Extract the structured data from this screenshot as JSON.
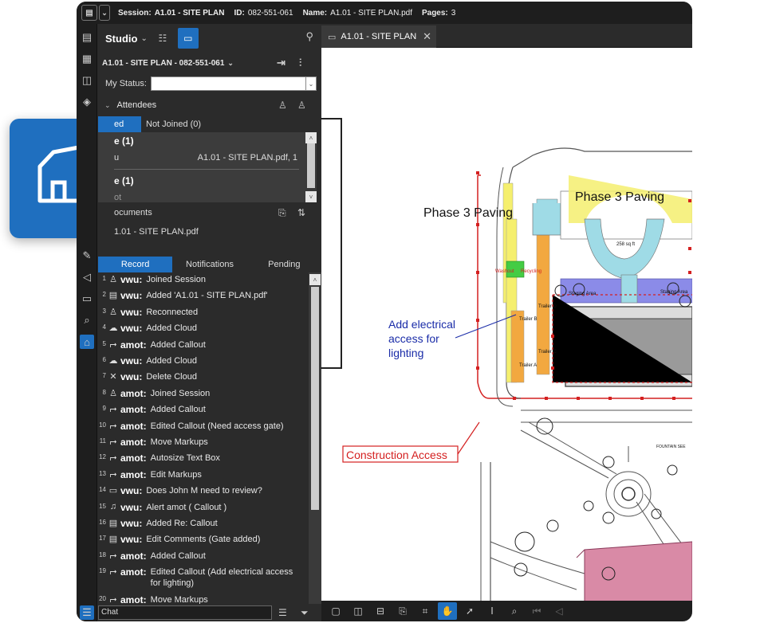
{
  "titlebar": {
    "session_label": "Session:",
    "session_value": "A1.01 - SITE PLAN",
    "id_label": "ID:",
    "id_value": "082-551-061",
    "name_label": "Name:",
    "name_value": "A1.01 - SITE PLAN.pdf",
    "pages_label": "Pages:",
    "pages_value": "3"
  },
  "panel": {
    "title": "Studio",
    "session_name": "A1.01 - SITE PLAN - 082-551-061",
    "status_label": "My Status:",
    "status_value": "",
    "attendees_label": "Attendees",
    "tabs": [
      {
        "label": "Joined"
      },
      {
        "label": "Not Joined (0)"
      }
    ],
    "visible_tab_text": "ed",
    "attendees": {
      "group1": "e (1)",
      "person1": "u",
      "person1_doc": "A1.01 - SITE PLAN.pdf, 1",
      "group2": "e (1)",
      "person2": "ot"
    },
    "documents_label": "ocuments",
    "document_item": "1.01 - SITE PLAN.pdf",
    "record_tabs": [
      {
        "label": "Record"
      },
      {
        "label": "Notifications"
      },
      {
        "label": "Pending"
      }
    ],
    "records": [
      {
        "num": "1",
        "icon": "person-icon",
        "user": "vwu:",
        "action": "Joined Session"
      },
      {
        "num": "2",
        "icon": "document-add-icon",
        "user": "vwu:",
        "action": "Added 'A1.01 - SITE PLAN.pdf'"
      },
      {
        "num": "3",
        "icon": "person-icon",
        "user": "vwu:",
        "action": "Reconnected"
      },
      {
        "num": "4",
        "icon": "cloud-icon",
        "user": "vwu:",
        "action": "Added Cloud"
      },
      {
        "num": "5",
        "icon": "callout-icon",
        "user": "amot:",
        "action": "Added Callout"
      },
      {
        "num": "6",
        "icon": "cloud-icon",
        "user": "vwu:",
        "action": "Added Cloud"
      },
      {
        "num": "7",
        "icon": "delete-icon",
        "user": "vwu:",
        "action": "Delete Cloud"
      },
      {
        "num": "8",
        "icon": "person-icon",
        "user": "amot:",
        "action": "Joined Session"
      },
      {
        "num": "9",
        "icon": "callout-icon",
        "user": "amot:",
        "action": "Added Callout"
      },
      {
        "num": "10",
        "icon": "callout-icon",
        "user": "amot:",
        "action": "Edited Callout (Need access gate)"
      },
      {
        "num": "11",
        "icon": "callout-icon",
        "user": "amot:",
        "action": "Move Markups"
      },
      {
        "num": "12",
        "icon": "callout-icon",
        "user": "amot:",
        "action": "Autosize Text Box"
      },
      {
        "num": "13",
        "icon": "callout-icon",
        "user": "amot:",
        "action": "Edit Markups"
      },
      {
        "num": "14",
        "icon": "comment-icon",
        "user": "vwu:",
        "action": "Does John M need to review?"
      },
      {
        "num": "15",
        "icon": "bell-icon",
        "user": "vwu:",
        "action": "Alert amot ( Callout )"
      },
      {
        "num": "16",
        "icon": "comments-list-icon",
        "user": "vwu:",
        "action": "Added Re: Callout"
      },
      {
        "num": "17",
        "icon": "comments-list-icon",
        "user": "vwu:",
        "action": "Edit Comments (Gate added)"
      },
      {
        "num": "18",
        "icon": "callout-icon",
        "user": "amot:",
        "action": "Added Callout"
      },
      {
        "num": "19",
        "icon": "callout-icon",
        "user": "amot:",
        "action": "Edited Callout (Add electrical access",
        "action2": "for lighting)"
      },
      {
        "num": "20",
        "icon": "callout-icon",
        "user": "amot:",
        "action": "Move Markups"
      }
    ],
    "chat_placeholder": "Chat"
  },
  "viewer": {
    "tab_label": "A1.01 - SITE PLAN",
    "drawing": {
      "phase3_a": "Phase 3 Paving",
      "phase3_b": "Phase 3 Paving",
      "electrical_callout": [
        "Add electrical",
        "access for",
        "lighting"
      ],
      "construction_access": "Construction Access",
      "trailer_b": "Trailer B",
      "trailer_c": "Trailer C",
      "trailer_d": "Trailer D",
      "trailer_a": "Trailer A",
      "staging_1": "Staging Area",
      "staging_2": "Staging Area",
      "fountain": "FOUNTAIN SEE",
      "washout": "Washout",
      "recycling": "Recycling",
      "sqft": "258 sq ft"
    }
  },
  "colors": {
    "accent": "#1f6fbf",
    "markup_red": "#d42020",
    "callout_blue": "#1a2ca8",
    "paving_yellow": "#f5ef6e",
    "hatched_pink": "#d98aa6",
    "staging_purple": "#8b8be8"
  }
}
